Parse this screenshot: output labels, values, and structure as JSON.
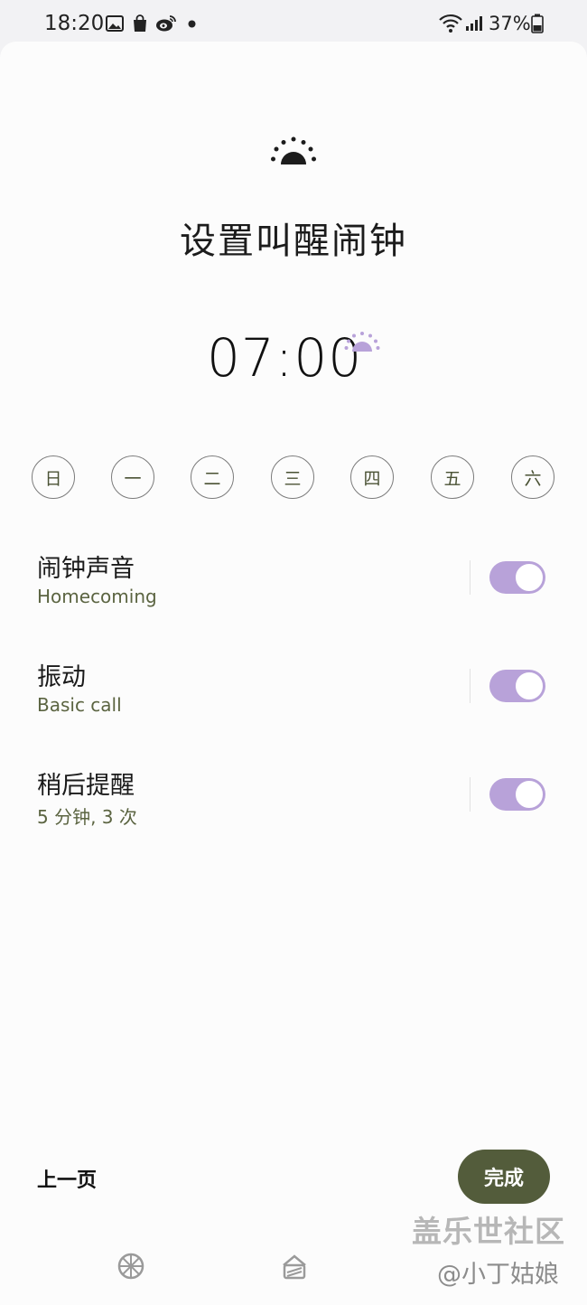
{
  "status_bar": {
    "time": "18:20",
    "battery": "37%",
    "icons": [
      "gallery-icon",
      "shopping-bag-icon",
      "weibo-icon",
      "notification-dot-icon",
      "wifi-icon",
      "signal-icon",
      "battery-icon"
    ]
  },
  "header": {
    "icon": "sunrise-icon",
    "title": "设置叫醒闹钟"
  },
  "alarm": {
    "time": "07:00",
    "icon": "sunrise-small-icon",
    "accent_color": "#b8a2d9"
  },
  "days": [
    "日",
    "一",
    "二",
    "三",
    "四",
    "五",
    "六"
  ],
  "settings": [
    {
      "label": "闹钟声音",
      "value": "Homecoming",
      "enabled": true
    },
    {
      "label": "振动",
      "value": "Basic call",
      "enabled": true
    },
    {
      "label": "稍后提醒",
      "value": "5 分钟, 3 次",
      "enabled": true
    }
  ],
  "footer": {
    "prev_label": "上一页",
    "done_label": "完成",
    "done_color": "#535c3b"
  },
  "watermark": {
    "line1": "盖乐世社区",
    "line2": "@小丁姑娘"
  },
  "nav": {
    "icons": [
      "pinwheel-icon",
      "stack-icon"
    ]
  }
}
